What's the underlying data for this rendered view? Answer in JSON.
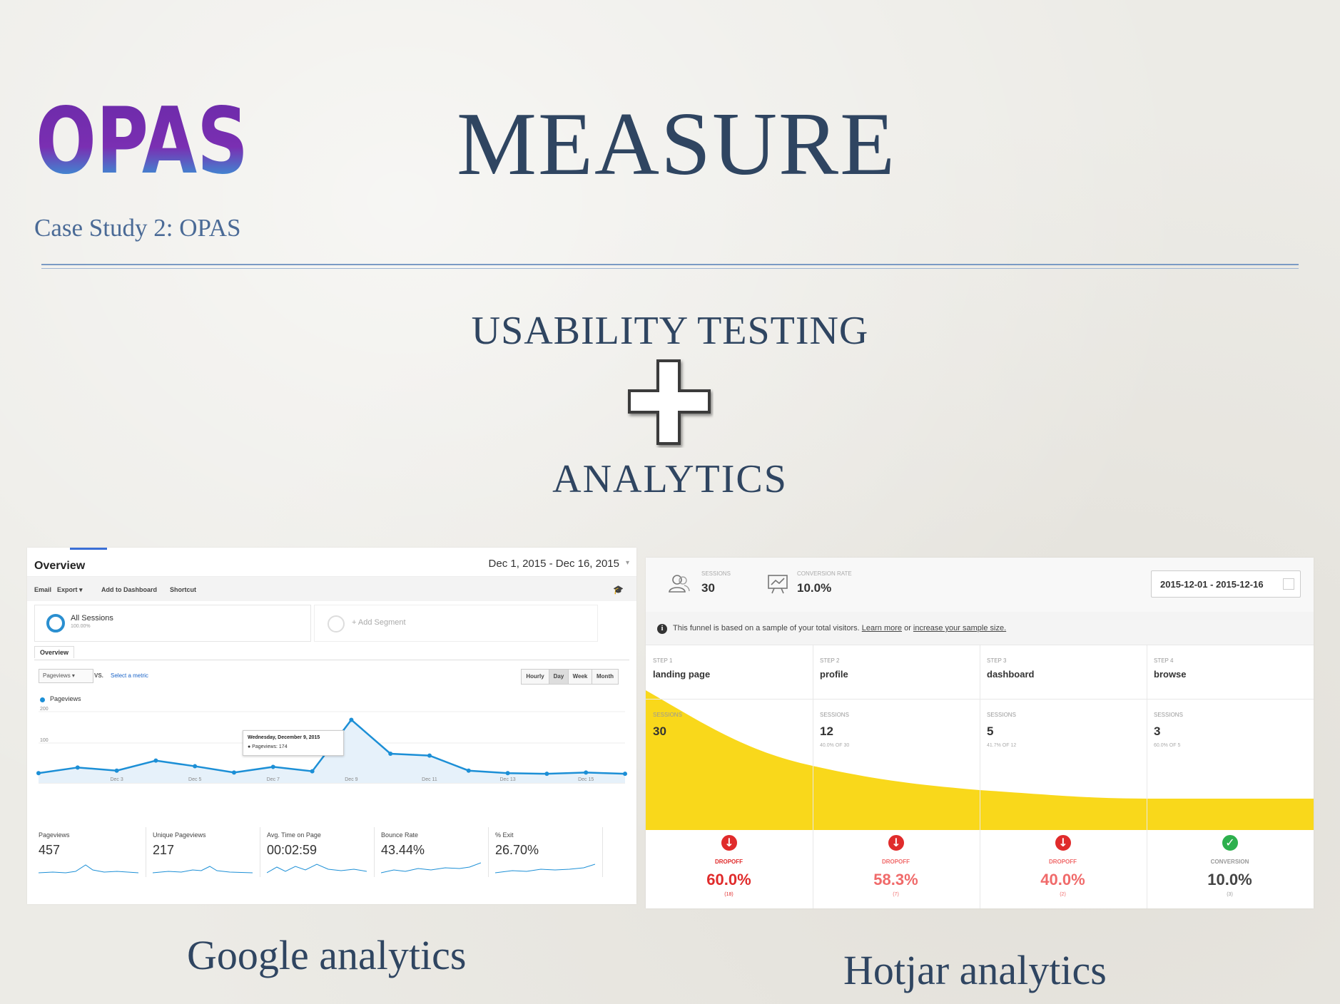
{
  "slide": {
    "title": "MEASURE",
    "case_study": "Case Study 2: OPAS",
    "logo_text": "OPAS",
    "headline_top": "USABILITY TESTING",
    "headline_bottom": "ANALYTICS",
    "caption_left": "Google analytics",
    "caption_right": "Hotjar analytics",
    "colors": {
      "title": "#2f4561",
      "case_study": "#4a6a96",
      "divider": "#7a9ac4",
      "logo_gradient_top": "#6a2aa8",
      "logo_gradient_bottom": "#19c3e6"
    },
    "plus_icon": "plus-icon"
  },
  "google_analytics": {
    "title": "Overview",
    "date_range": "Dec 1, 2015 - Dec 16, 2015",
    "toolbar": [
      "Email",
      "Export ▾",
      "Add to Dashboard",
      "Shortcut"
    ],
    "segment_primary": "All Sessions",
    "segment_primary_sub": "100.00%",
    "segment_add": "+ Add Segment",
    "tab": "Overview",
    "metric_select": "Pageviews  ▾",
    "vs_label": "VS.",
    "select_metric": "Select a metric",
    "granularity": [
      "Hourly",
      "Day",
      "Week",
      "Month"
    ],
    "granularity_active": "Day",
    "legend": "Pageviews",
    "tooltip_date": "Wednesday, December 9, 2015",
    "tooltip_value": "● Pageviews: 174",
    "accent_color": "#1c8fd6",
    "chart_data": {
      "type": "area",
      "series": [
        {
          "name": "Pageviews",
          "values": [
            4,
            22,
            12,
            44,
            26,
            6,
            24,
            10,
            174,
            66,
            60,
            12,
            4,
            2,
            6,
            2
          ]
        }
      ],
      "x": [
        "Dec 1",
        "Dec 2",
        "Dec 3",
        "Dec 4",
        "Dec 5",
        "Dec 6",
        "Dec 7",
        "Dec 8",
        "Dec 9",
        "Dec 10",
        "Dec 11",
        "Dec 12",
        "Dec 13",
        "Dec 14",
        "Dec 15",
        "Dec 16"
      ],
      "x_tick_labels": [
        "Dec 3",
        "Dec 5",
        "Dec 7",
        "Dec 9",
        "Dec 11",
        "Dec 13",
        "Dec 15"
      ],
      "y_tick_labels": [
        "200",
        "100"
      ],
      "ylim": [
        0,
        200
      ]
    },
    "stats": [
      {
        "label": "Pageviews",
        "value": "457"
      },
      {
        "label": "Unique Pageviews",
        "value": "217"
      },
      {
        "label": "Avg. Time on Page",
        "value": "00:02:59"
      },
      {
        "label": "Bounce Rate",
        "value": "43.44%"
      },
      {
        "label": "% Exit",
        "value": "26.70%"
      }
    ]
  },
  "hotjar": {
    "sessions_label": "SESSIONS",
    "sessions_value": "30",
    "conversion_label": "CONVERSION RATE",
    "conversion_value": "10.0%",
    "date_range": "2015-12-01 - 2015-12-16",
    "info_prefix": "This funnel is based on a sample of your total visitors.",
    "info_link1": "Learn more",
    "info_mid": "or",
    "info_link2": "increase your sample size.",
    "funnel_color": "#f9d81b",
    "steps": [
      {
        "kicker": "STEP 1",
        "name": "landing page",
        "sessions_label": "SESSIONS",
        "sessions": "30",
        "share": "",
        "outcome_label": "DROPOFF",
        "outcome": "60.0%",
        "outcome_count": "(18)",
        "kind": "dropoff"
      },
      {
        "kicker": "STEP 2",
        "name": "profile",
        "sessions_label": "SESSIONS",
        "sessions": "12",
        "share": "40.0% OF 30",
        "outcome_label": "DROPOFF",
        "outcome": "58.3%",
        "outcome_count": "(7)",
        "kind": "dropoff"
      },
      {
        "kicker": "STEP 3",
        "name": "dashboard",
        "sessions_label": "SESSIONS",
        "sessions": "5",
        "share": "41.7% OF 12",
        "outcome_label": "DROPOFF",
        "outcome": "40.0%",
        "outcome_count": "(2)",
        "kind": "dropoff"
      },
      {
        "kicker": "STEP 4",
        "name": "browse",
        "sessions_label": "SESSIONS",
        "sessions": "3",
        "share": "60.0% OF 5",
        "outcome_label": "CONVERSION",
        "outcome": "10.0%",
        "outcome_count": "(3)",
        "kind": "conversion"
      }
    ]
  }
}
